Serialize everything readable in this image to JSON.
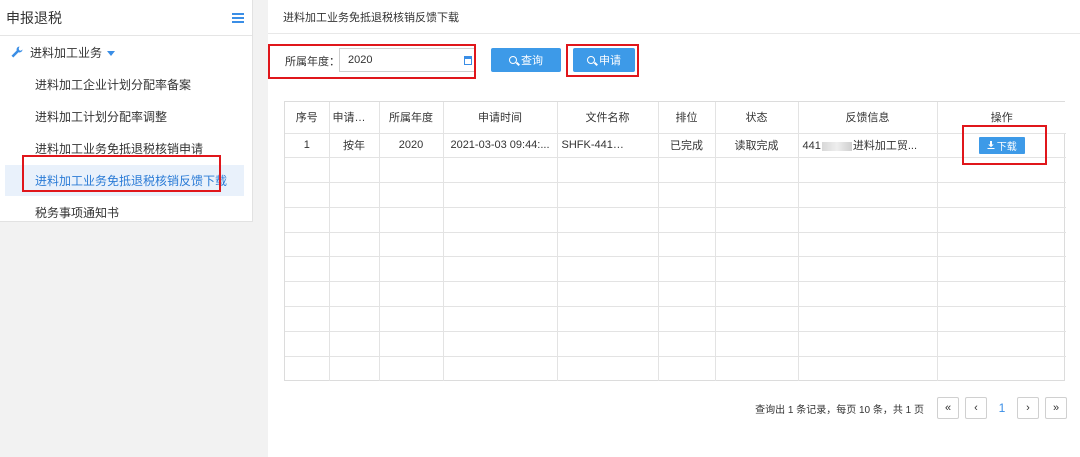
{
  "sidebar": {
    "title": "申报退税",
    "group_label": "进料加工业务",
    "items": [
      {
        "label": "进料加工企业计划分配率备案"
      },
      {
        "label": "进料加工计划分配率调整"
      },
      {
        "label": "进料加工业务免抵退税核销申请"
      },
      {
        "label": "进料加工业务免抵退税核销反馈下载",
        "active": true
      },
      {
        "label": "税务事项通知书"
      }
    ]
  },
  "main": {
    "title": "进料加工业务免抵退税核销反馈下载",
    "year_label": "所属年度：",
    "year_value": "2020",
    "query_label": "查询",
    "apply_label": "申请"
  },
  "table": {
    "headers": [
      "序号",
      "申请类型",
      "所属年度",
      "申请时间",
      "文件名称",
      "排位",
      "状态",
      "反馈信息",
      "操作"
    ],
    "rows": [
      {
        "index": "1",
        "type": "按年",
        "year": "2020",
        "time": "2021-03-03 09:44:...",
        "file_prefix": "SHFK-441",
        "file_suffix": ".",
        "rank": "已完成",
        "status": "读取完成",
        "feedback_prefix": "441",
        "feedback_suffix": "进料加工贸...",
        "action": "下载"
      }
    ]
  },
  "pagination": {
    "info": "查询出 1 条记录，每页 10 条，共 1 页",
    "first": "«",
    "prev": "‹",
    "current": "1",
    "next": "›",
    "last": "»"
  },
  "colors": {
    "accent": "#3d9ae8",
    "highlight_border": "#e0161b",
    "active_item_bg": "#e9f1fb"
  }
}
